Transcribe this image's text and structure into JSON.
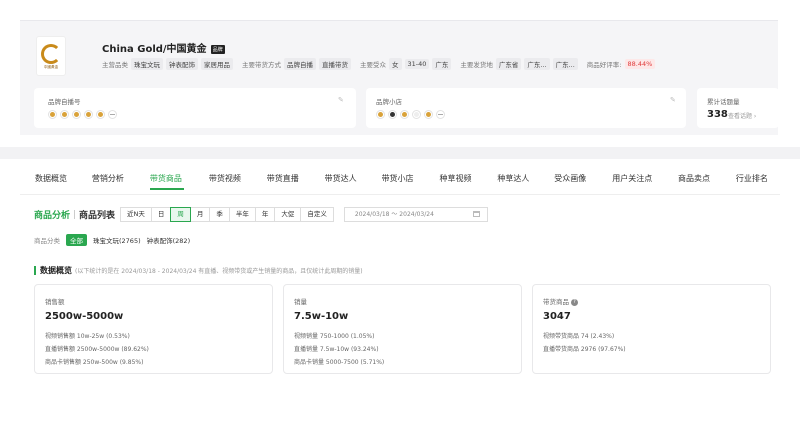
{
  "brand": {
    "name": "China Gold/中国黄金",
    "badge": "品牌",
    "logo_text": "中國黃金",
    "meta": {
      "main_category_label": "主营品类",
      "main_categories": [
        "珠宝文玩",
        "钟表配饰",
        "家居用品"
      ],
      "sales_method_label": "主要带货方式",
      "sales_methods": [
        "品牌自播",
        "直播带货"
      ],
      "audience_label": "主要受众",
      "audience": [
        "女",
        "31-40",
        "广东"
      ],
      "ship_label": "主要发货地",
      "ship_from": [
        "广东省",
        "广东...",
        "广东..."
      ],
      "rating_label": "商品好评率:",
      "rating_value": "88.44%"
    }
  },
  "cards": {
    "self_broadcast": {
      "title": "品牌自播号",
      "edit_icon": "edit-icon"
    },
    "shop": {
      "title": "品牌小店",
      "edit_icon": "edit-icon"
    },
    "topics": {
      "title": "累计话题量",
      "value": "338",
      "link": "查看话题 ›"
    }
  },
  "tabs": [
    "数据概览",
    "营销分析",
    "带货商品",
    "带货视频",
    "带货直播",
    "带货达人",
    "带货小店",
    "种草视频",
    "种草达人",
    "受众画像",
    "用户关注点",
    "商品卖点",
    "行业排名"
  ],
  "active_tab": 2,
  "subbar": {
    "analysis": "商品分析",
    "list": "商品列表",
    "periods": [
      "近N天",
      "日",
      "周",
      "月",
      "季",
      "半年",
      "年",
      "大促",
      "自定义"
    ],
    "active_period": 2,
    "date_range": "2024/03/18 ～ 2024/03/24"
  },
  "categories": {
    "label": "商品分类",
    "chips": [
      "全部",
      "珠宝文玩(2765)",
      "钟表配饰(282)"
    ]
  },
  "overview": {
    "title": "数据概览",
    "note": "(以下统计的是在 2024/03/18 - 2024/03/24 有直播、视频带货或产生销量的商品，且仅统计此周期的销量)",
    "kpis": [
      {
        "title": "销售额",
        "value": "2500w-5000w",
        "lines": [
          "视频销售额 10w-25w (0.53%)",
          "直播销售额 2500w-5000w (89.62%)",
          "商品卡销售额 250w-500w (9.85%)"
        ]
      },
      {
        "title": "销量",
        "value": "7.5w-10w",
        "lines": [
          "视频销量 750-1000 (1.05%)",
          "直播销量 7.5w-10w (93.24%)",
          "商品卡销量 5000-7500 (5.71%)"
        ]
      },
      {
        "title": "带货商品",
        "value": "3047",
        "help": "?",
        "lines": [
          "视频带货商品 74 (2.43%)",
          "直播带货商品 2976 (97.67%)"
        ]
      }
    ]
  }
}
